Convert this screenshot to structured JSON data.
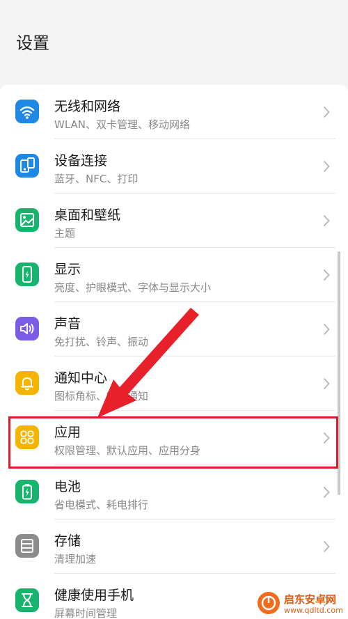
{
  "header": {
    "title": "设置"
  },
  "items": [
    {
      "label": "无线和网络",
      "sub": "WLAN、双卡管理、移动网络",
      "icon": "wifi-icon",
      "color": "#1e88e5"
    },
    {
      "label": "设备连接",
      "sub": "蓝牙、NFC、打印",
      "icon": "device-connection-icon",
      "color": "#1e88e5"
    },
    {
      "label": "桌面和壁纸",
      "sub": "主题",
      "icon": "wallpaper-icon",
      "color": "#16b46c"
    },
    {
      "label": "显示",
      "sub": "亮度、护眼模式、字体与显示大小",
      "icon": "display-icon",
      "color": "#16b46c"
    },
    {
      "label": "声音",
      "sub": "免打扰、铃声、振动",
      "icon": "sound-icon",
      "color": "#7b5ce6"
    },
    {
      "label": "通知中心",
      "sub": "图标角标、锁屏通知",
      "icon": "bell-icon",
      "color": "#f5b400"
    },
    {
      "label": "应用",
      "sub": "权限管理、默认应用、应用分身",
      "icon": "apps-grid-icon",
      "color": "#f5b400"
    },
    {
      "label": "电池",
      "sub": "省电模式、耗电排行",
      "icon": "battery-icon",
      "color": "#16b46c"
    },
    {
      "label": "存储",
      "sub": "清理加速",
      "icon": "storage-icon",
      "color": "#8c8c8c"
    },
    {
      "label": "健康使用手机",
      "sub": "屏幕时间管理",
      "icon": "hourglass-icon",
      "color": "#16b46c"
    }
  ],
  "watermark": {
    "title": "启东安卓网",
    "url": "www.qdltd.com"
  },
  "colors": {
    "highlight": "#d61e2c",
    "background": "#f4f4f4"
  }
}
